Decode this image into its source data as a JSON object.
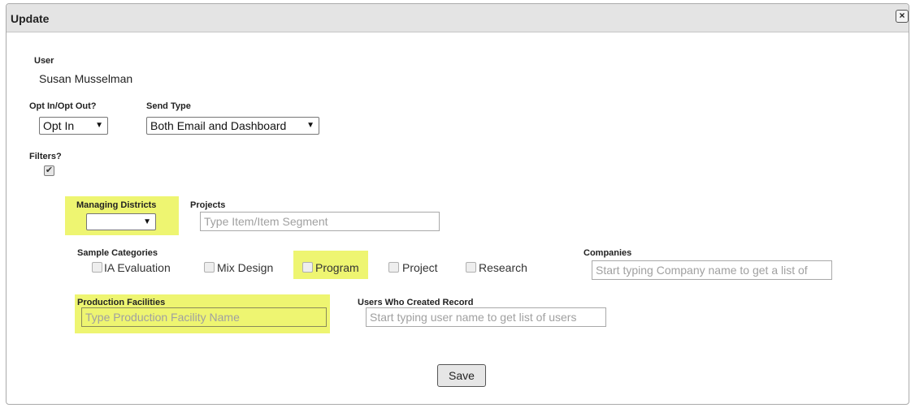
{
  "dialog": {
    "title": "Update",
    "close_symbol": "×"
  },
  "user": {
    "label": "User",
    "value": "Susan Musselman"
  },
  "opt": {
    "label": "Opt In/Opt Out?",
    "selected": "Opt In"
  },
  "send_type": {
    "label": "Send Type",
    "selected": "Both Email and Dashboard"
  },
  "filters": {
    "label": "Filters?",
    "checked": true,
    "check_symbol": "✔"
  },
  "managing_districts": {
    "label": "Managing Districts",
    "selected": ""
  },
  "projects": {
    "label": "Projects",
    "placeholder": "Type Item/Item Segment"
  },
  "sample_categories": {
    "label": "Sample Categories",
    "options": [
      {
        "label": "IA Evaluation",
        "checked": false
      },
      {
        "label": "Mix Design",
        "checked": false
      },
      {
        "label": "Program",
        "checked": false
      },
      {
        "label": "Project",
        "checked": false
      },
      {
        "label": "Research",
        "checked": false
      }
    ]
  },
  "companies": {
    "label": "Companies",
    "placeholder": "Start typing Company name to get a list of"
  },
  "production_facilities": {
    "label": "Production Facilities",
    "placeholder": "Type Production Facility Name"
  },
  "users_created": {
    "label": "Users Who Created Record",
    "placeholder": "Start typing user name to get list of users"
  },
  "save_label": "Save",
  "colors": {
    "highlight": "#eef571",
    "titlebar": "#e4e4e4"
  }
}
